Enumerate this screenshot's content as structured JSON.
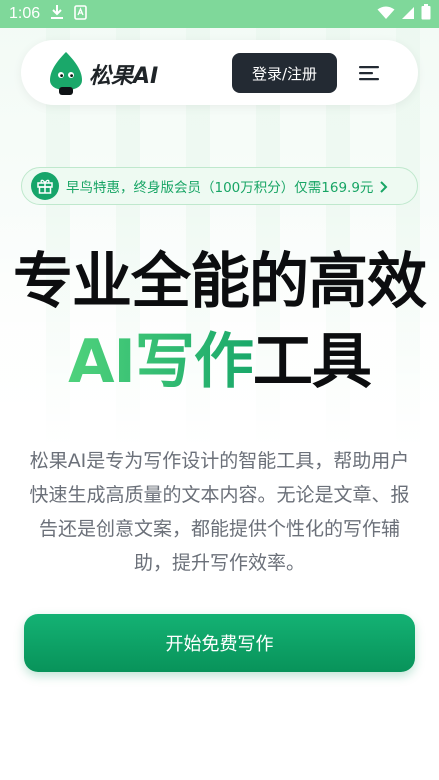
{
  "status_bar": {
    "time": "1:06",
    "icons": [
      "download-icon",
      "sim-alert-icon",
      "wifi-icon",
      "signal-icon",
      "battery-icon"
    ]
  },
  "nav": {
    "brand": "松果AI",
    "login_label": "登录/注册",
    "menu_icon": "menu-icon"
  },
  "promo": {
    "text": "早鸟特惠，终身版会员（100万积分）仅需169.9元",
    "icon": "gift-icon"
  },
  "hero": {
    "line1": "专业全能的高效",
    "line2_accent": "AI写作",
    "line2_rest": "工具"
  },
  "description": "松果AI是专为写作设计的智能工具，帮助用户快速生成高质量的文本内容。无论是文章、报告还是创意文案，都能提供个性化的写作辅助，提升写作效率。",
  "cta": {
    "label": "开始免费写作"
  },
  "colors": {
    "status_bar": "#7fd89a",
    "accent_green": "#17a56b",
    "dark_button": "#232a33"
  }
}
